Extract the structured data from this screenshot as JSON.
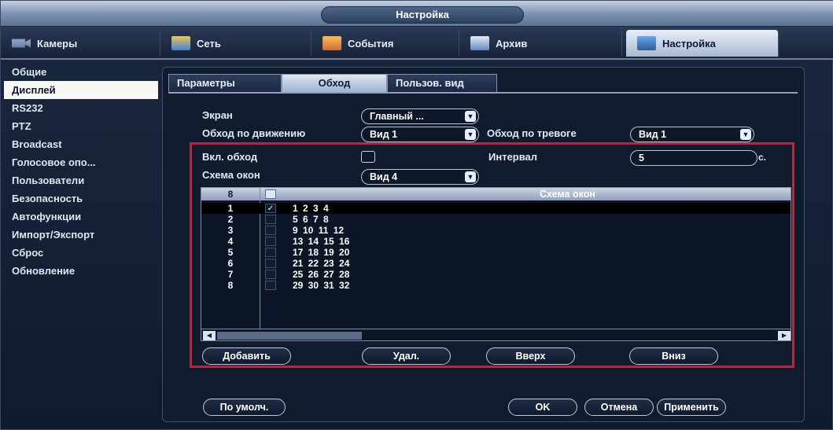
{
  "window": {
    "title": "Настройка"
  },
  "topnav": {
    "tabs": [
      {
        "label": "Камеры",
        "icon": "camera-icon"
      },
      {
        "label": "Сеть",
        "icon": "network-icon"
      },
      {
        "label": "События",
        "icon": "events-icon"
      },
      {
        "label": "Архив",
        "icon": "archive-icon"
      },
      {
        "label": "Настройка",
        "icon": "settings-icon",
        "active": true
      }
    ]
  },
  "sidebar": {
    "items": [
      {
        "label": "Общие"
      },
      {
        "label": "Дисплей",
        "active": true
      },
      {
        "label": "RS232"
      },
      {
        "label": "PTZ"
      },
      {
        "label": "Broadcast"
      },
      {
        "label": "Голосовое опо..."
      },
      {
        "label": "Пользователи"
      },
      {
        "label": "Безопасность"
      },
      {
        "label": "Автофункции"
      },
      {
        "label": "Импорт/Экспорт"
      },
      {
        "label": "Сброс"
      },
      {
        "label": "Обновление"
      }
    ]
  },
  "subtabs": [
    {
      "label": "Параметры"
    },
    {
      "label": "Обход",
      "active": true
    },
    {
      "label": "Пользов. вид"
    }
  ],
  "form": {
    "screen_label": "Экран",
    "screen_value": "Главный ...",
    "motion_tour_label": "Обход по движению",
    "motion_tour_value": "Вид 1",
    "alarm_tour_label": "Обход по тревоге",
    "alarm_tour_value": "Вид 1",
    "enable_tour_label": "Вкл. обход",
    "enable_tour_checked": false,
    "interval_label": "Интервал",
    "interval_value": "5",
    "interval_unit": "с.",
    "layout_label": "Схема окон",
    "layout_value": "Вид 4"
  },
  "table": {
    "header_count": "8",
    "header_title": "Схема окон",
    "rows": [
      {
        "num": "1",
        "checked": true,
        "channels": "1  2  3  4",
        "selected": true
      },
      {
        "num": "2",
        "checked": false,
        "channels": "5  6  7  8"
      },
      {
        "num": "3",
        "checked": false,
        "channels": "9  10  11  12"
      },
      {
        "num": "4",
        "checked": false,
        "channels": "13  14  15  16"
      },
      {
        "num": "5",
        "checked": false,
        "channels": "17  18  19  20"
      },
      {
        "num": "6",
        "checked": false,
        "channels": "21  22  23  24"
      },
      {
        "num": "7",
        "checked": false,
        "channels": "25  26  27  28"
      },
      {
        "num": "8",
        "checked": false,
        "channels": "29  30  31  32"
      }
    ],
    "check_mark": "✓"
  },
  "table_buttons": {
    "add": "Добавить",
    "delete": "Удал.",
    "up": "Вверх",
    "down": "Вниз"
  },
  "footer": {
    "default": "По умолч.",
    "ok": "OK",
    "cancel": "Отмена",
    "apply": "Применить"
  },
  "colors": {
    "highlight_box": "#e3152b",
    "active_sidebar_bg": "#f7f7f4"
  }
}
